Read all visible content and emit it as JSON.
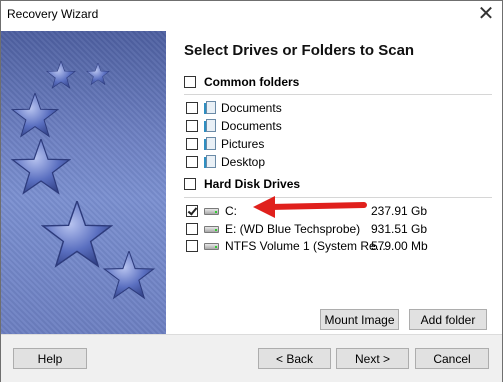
{
  "window": {
    "title": "Recovery Wizard",
    "close_glyph": "✕"
  },
  "main": {
    "heading": "Select Drives or Folders to Scan",
    "common_folders": {
      "label": "Common folders",
      "items": [
        {
          "label": "Documents",
          "icon": "folder-icon",
          "checked": false
        },
        {
          "label": "Documents",
          "icon": "folder-icon",
          "checked": false
        },
        {
          "label": "Pictures",
          "icon": "folder-icon",
          "checked": false
        },
        {
          "label": "Desktop",
          "icon": "folder-icon",
          "checked": false
        }
      ]
    },
    "hard_disk_drives": {
      "label": "Hard Disk Drives",
      "items": [
        {
          "label": "C:",
          "size": "237.91 Gb",
          "icon": "hard-drive-icon",
          "checked": true
        },
        {
          "label": "E: (WD Blue Techsprobe)",
          "size": "931.51 Gb",
          "icon": "hard-drive-icon",
          "checked": false
        },
        {
          "label": "NTFS Volume 1 (System Re...",
          "size": "579.00 Mb",
          "icon": "hard-drive-icon",
          "checked": false
        }
      ]
    },
    "buttons": {
      "mount_image": "Mount Image",
      "add_folder": "Add folder"
    }
  },
  "footer": {
    "help": "Help",
    "back": "< Back",
    "next": "Next >",
    "cancel": "Cancel"
  },
  "colors": {
    "annotation_arrow": "#e0201c",
    "sidebar": "#6d80c2"
  }
}
